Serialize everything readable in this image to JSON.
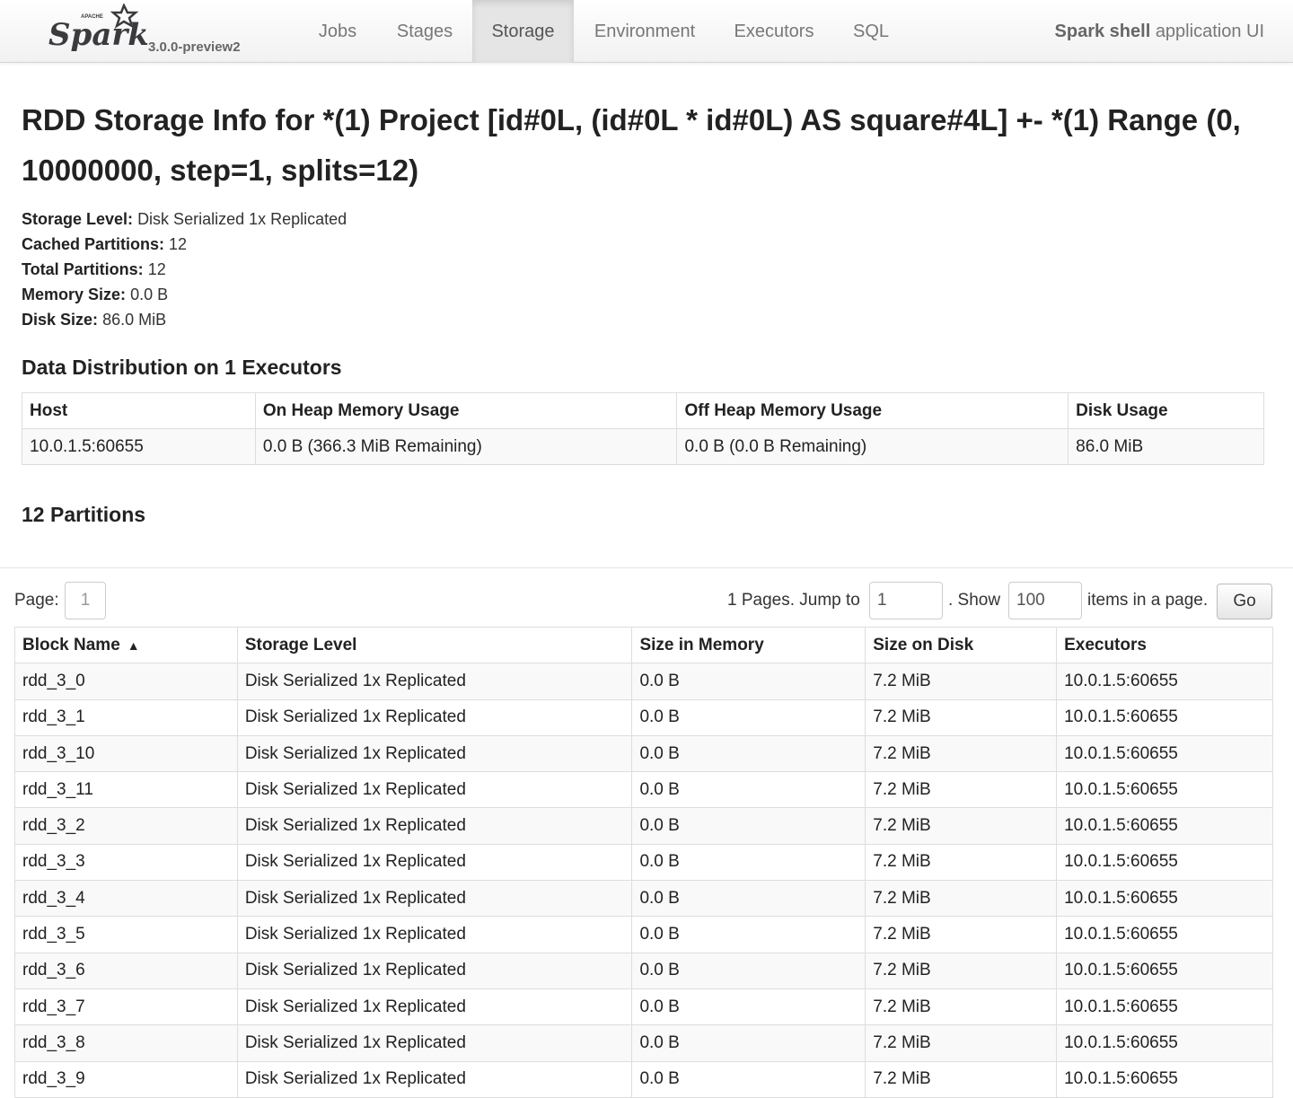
{
  "navbar": {
    "logo_text": "Spark",
    "logo_apache": "APACHE",
    "version": "3.0.0-preview2",
    "tabs": [
      {
        "label": "Jobs"
      },
      {
        "label": "Stages"
      },
      {
        "label": "Storage"
      },
      {
        "label": "Environment"
      },
      {
        "label": "Executors"
      },
      {
        "label": "SQL"
      }
    ],
    "active_tab": "Storage",
    "app_name_bold": "Spark shell",
    "app_name_suffix": "application UI"
  },
  "page_title": "RDD Storage Info for *(1) Project [id#0L, (id#0L * id#0L) AS square#4L] +- *(1) Range (0, 10000000, step=1, splits=12)",
  "summary": [
    {
      "label": "Storage Level:",
      "value": "Disk Serialized 1x Replicated"
    },
    {
      "label": "Cached Partitions:",
      "value": "12"
    },
    {
      "label": "Total Partitions:",
      "value": "12"
    },
    {
      "label": "Memory Size:",
      "value": "0.0 B"
    },
    {
      "label": "Disk Size:",
      "value": "86.0 MiB"
    }
  ],
  "distribution": {
    "title": "Data Distribution on 1 Executors",
    "headers": [
      "Host",
      "On Heap Memory Usage",
      "Off Heap Memory Usage",
      "Disk Usage"
    ],
    "rows": [
      [
        "10.0.1.5:60655",
        "0.0 B (366.3 MiB Remaining)",
        "0.0 B (0.0 B Remaining)",
        "86.0 MiB"
      ]
    ]
  },
  "partitions": {
    "title": "12 Partitions",
    "pager": {
      "page_label": "Page:",
      "page_value": "1",
      "pages_text": "1 Pages. Jump to",
      "jump_value": "1",
      "show_text": ". Show",
      "show_value": "100",
      "items_text": "items in a page.",
      "go_label": "Go"
    },
    "headers": [
      "Block Name",
      "Storage Level",
      "Size in Memory",
      "Size on Disk",
      "Executors"
    ],
    "sort_indicator": "▲",
    "rows": [
      [
        "rdd_3_0",
        "Disk Serialized 1x Replicated",
        "0.0 B",
        "7.2 MiB",
        "10.0.1.5:60655"
      ],
      [
        "rdd_3_1",
        "Disk Serialized 1x Replicated",
        "0.0 B",
        "7.2 MiB",
        "10.0.1.5:60655"
      ],
      [
        "rdd_3_10",
        "Disk Serialized 1x Replicated",
        "0.0 B",
        "7.2 MiB",
        "10.0.1.5:60655"
      ],
      [
        "rdd_3_11",
        "Disk Serialized 1x Replicated",
        "0.0 B",
        "7.2 MiB",
        "10.0.1.5:60655"
      ],
      [
        "rdd_3_2",
        "Disk Serialized 1x Replicated",
        "0.0 B",
        "7.2 MiB",
        "10.0.1.5:60655"
      ],
      [
        "rdd_3_3",
        "Disk Serialized 1x Replicated",
        "0.0 B",
        "7.2 MiB",
        "10.0.1.5:60655"
      ],
      [
        "rdd_3_4",
        "Disk Serialized 1x Replicated",
        "0.0 B",
        "7.2 MiB",
        "10.0.1.5:60655"
      ],
      [
        "rdd_3_5",
        "Disk Serialized 1x Replicated",
        "0.0 B",
        "7.2 MiB",
        "10.0.1.5:60655"
      ],
      [
        "rdd_3_6",
        "Disk Serialized 1x Replicated",
        "0.0 B",
        "7.2 MiB",
        "10.0.1.5:60655"
      ],
      [
        "rdd_3_7",
        "Disk Serialized 1x Replicated",
        "0.0 B",
        "7.2 MiB",
        "10.0.1.5:60655"
      ],
      [
        "rdd_3_8",
        "Disk Serialized 1x Replicated",
        "0.0 B",
        "7.2 MiB",
        "10.0.1.5:60655"
      ],
      [
        "rdd_3_9",
        "Disk Serialized 1x Replicated",
        "0.0 B",
        "7.2 MiB",
        "10.0.1.5:60655"
      ]
    ]
  },
  "colors": {
    "logo_text": "#3c3a3e",
    "logo_star": "#e25a1c",
    "active_tab_bg": "#e5e5e5"
  }
}
